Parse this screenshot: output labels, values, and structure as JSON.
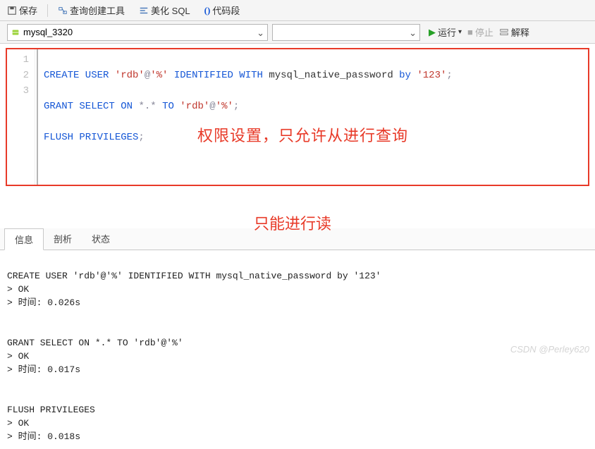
{
  "toolbar": {
    "save": "保存",
    "query_builder": "查询创建工具",
    "beautify": "美化 SQL",
    "snippets": "代码段"
  },
  "row2": {
    "connection": "mysql_3320",
    "database": "",
    "run": "运行",
    "stop": "停止",
    "explain": "解释"
  },
  "gutter": [
    "1",
    "2",
    "3"
  ],
  "sql": {
    "line1": {
      "kw1": "CREATE USER",
      "str1": "'rdb'",
      "at": "@",
      "str2": "'%'",
      "kw2": "IDENTIFIED WITH",
      "ident": "mysql_native_password",
      "kw3": "by",
      "str3": "'123'",
      "semi": ";"
    },
    "line2": {
      "kw1": "GRANT SELECT ON",
      "op": "*.*",
      "kw2": "TO",
      "str1": "'rdb'",
      "at": "@",
      "str2": "'%'",
      "semi": ";"
    },
    "line3": {
      "kw1": "FLUSH PRIVILEGES",
      "semi": ";"
    }
  },
  "annot": {
    "a1": "权限设置，只允许从进行查询",
    "a2": "只能进行读"
  },
  "tabs": {
    "info": "信息",
    "profile": "剖析",
    "status": "状态"
  },
  "results": {
    "r1_stmt": "CREATE USER 'rdb'@'%' IDENTIFIED WITH mysql_native_password by '123'",
    "r1_ok": "> OK",
    "r1_time": "> 时间: 0.026s",
    "r2_stmt": "GRANT SELECT ON *.* TO 'rdb'@'%'",
    "r2_ok": "> OK",
    "r2_time": "> 时间: 0.017s",
    "r3_stmt": "FLUSH PRIVILEGES",
    "r3_ok": "> OK",
    "r3_time": "> 时间: 0.018s"
  },
  "watermark": "CSDN @Perley620"
}
